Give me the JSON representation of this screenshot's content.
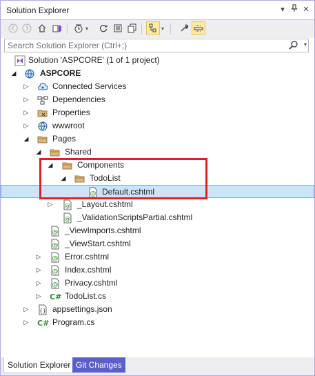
{
  "window": {
    "title": "Solution Explorer"
  },
  "search": {
    "placeholder": "Search Solution Explorer (Ctrl+;)"
  },
  "tree": [
    {
      "label": "Solution 'ASPCORE' (1 of 1 project)",
      "icon": "solution-icon",
      "toggle": ""
    },
    {
      "label": "ASPCORE",
      "icon": "web-project-icon",
      "toggle": "expanded"
    },
    {
      "label": "Connected Services",
      "icon": "connected-services-icon",
      "toggle": "collapsed"
    },
    {
      "label": "Dependencies",
      "icon": "dependencies-icon",
      "toggle": "collapsed"
    },
    {
      "label": "Properties",
      "icon": "folder-icon",
      "toggle": "collapsed"
    },
    {
      "label": "wwwroot",
      "icon": "globe-icon",
      "toggle": "collapsed"
    },
    {
      "label": "Pages",
      "icon": "folder-icon",
      "toggle": "expanded"
    },
    {
      "label": "Shared",
      "icon": "folder-icon",
      "toggle": "expanded"
    },
    {
      "label": "Components",
      "icon": "folder-icon",
      "toggle": "expanded"
    },
    {
      "label": "TodoList",
      "icon": "folder-icon",
      "toggle": "expanded"
    },
    {
      "label": "Default.cshtml",
      "icon": "razor-file-icon",
      "toggle": ""
    },
    {
      "label": "_Layout.cshtml",
      "icon": "razor-file-icon",
      "toggle": "collapsed"
    },
    {
      "label": "_ValidationScriptsPartial.cshtml",
      "icon": "razor-file-icon",
      "toggle": ""
    },
    {
      "label": "_ViewImports.cshtml",
      "icon": "razor-file-icon",
      "toggle": ""
    },
    {
      "label": "_ViewStart.cshtml",
      "icon": "razor-file-icon",
      "toggle": ""
    },
    {
      "label": "Error.cshtml",
      "icon": "razor-file-icon",
      "toggle": "collapsed"
    },
    {
      "label": "Index.cshtml",
      "icon": "razor-file-icon",
      "toggle": "collapsed"
    },
    {
      "label": "Privacy.cshtml",
      "icon": "razor-file-icon",
      "toggle": "collapsed"
    },
    {
      "label": "TodoList.cs",
      "icon": "csharp-file-icon",
      "toggle": "collapsed"
    },
    {
      "label": "appsettings.json",
      "icon": "json-file-icon",
      "toggle": "collapsed"
    },
    {
      "label": "Program.cs",
      "icon": "csharp-file-icon",
      "toggle": "collapsed"
    }
  ],
  "selected_item": "Default.cshtml",
  "tabs": [
    {
      "label": "Solution Explorer"
    },
    {
      "label": "Git Changes"
    }
  ],
  "colors": {
    "accent": "#5b5fc7",
    "selection": "#cce4f7",
    "highlight_box": "#e02027",
    "folder": "#dcb67a"
  }
}
